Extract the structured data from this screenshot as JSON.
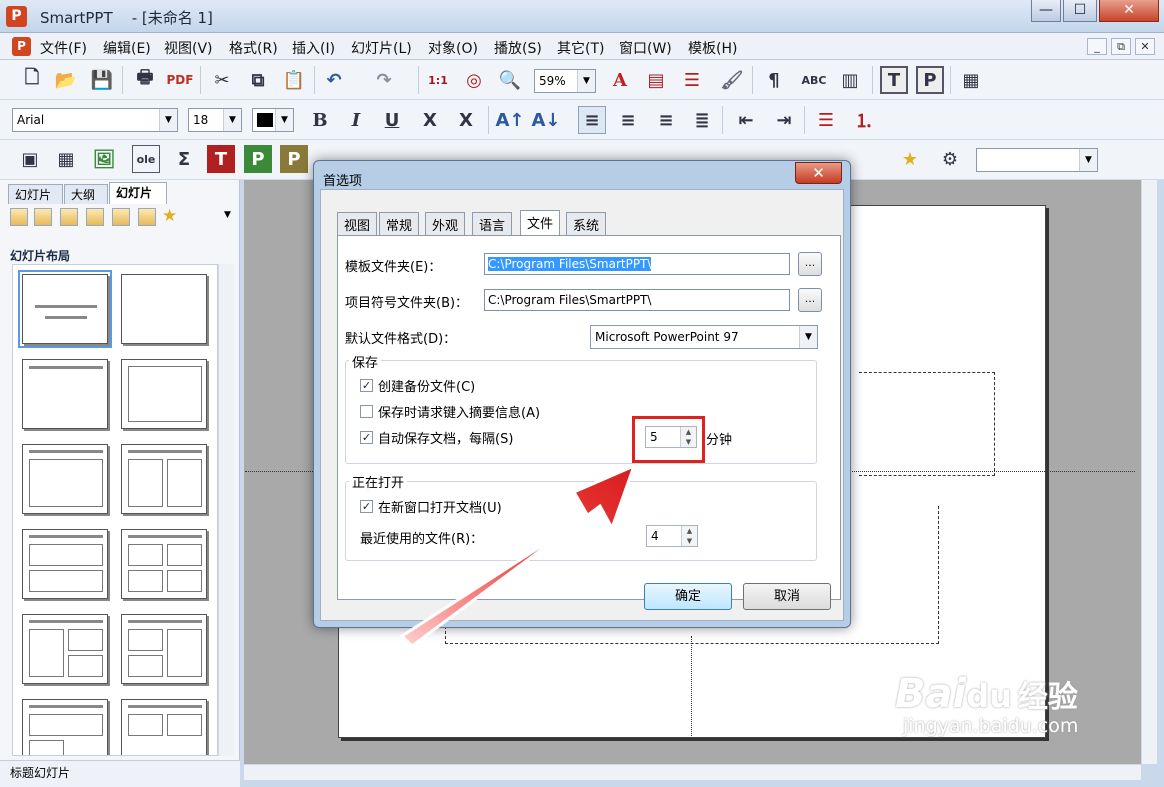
{
  "window": {
    "app_icon": "P",
    "title": "SmartPPT    - [未命名 1]",
    "controls": {
      "minimize": "—",
      "maximize": "☐",
      "close": "✕"
    }
  },
  "menu": {
    "logo": "P",
    "items": [
      "文件(F)",
      "编辑(E)",
      "视图(V)",
      "格式(R)",
      "插入(I)",
      "幻灯片(L)",
      "对象(O)",
      "播放(S)",
      "其它(T)",
      "窗口(W)",
      "模板(H)"
    ],
    "mdi_controls": [
      "_",
      "⧉",
      "✕"
    ]
  },
  "toolbar": {
    "zoom": "59%",
    "font_name": "Arial",
    "font_size": "18"
  },
  "left_panel": {
    "tabs": [
      "幻灯片",
      "大纲",
      "幻灯片"
    ],
    "layout_title": "幻灯片布局",
    "status": "标题幻灯片"
  },
  "dialog": {
    "title": "首选项",
    "close": "✕",
    "tabs": [
      "视图",
      "常规",
      "外观",
      "语言",
      "文件",
      "系统"
    ],
    "active_tab": "文件",
    "template_folder_label": "模板文件夹(E)：",
    "template_folder_value": "C:\\Program Files\\SmartPPT\\",
    "bullet_folder_label": "项目符号文件夹(B)：",
    "bullet_folder_value": "C:\\Program Files\\SmartPPT\\",
    "browse": "...",
    "default_format_label": "默认文件格式(D)：",
    "default_format_value": "Microsoft PowerPoint 97",
    "save_group": "保存",
    "backup_label": "创建备份文件(C)",
    "backup_checked": true,
    "summary_label": "保存时请求键入摘要信息(A)",
    "summary_checked": false,
    "autosave_label": "自动保存文档，每隔(S)",
    "autosave_checked": true,
    "autosave_minutes": "5",
    "minutes_unit": "分钟",
    "open_group": "正在打开",
    "new_window_label": "在新窗口打开文档(U)",
    "new_window_checked": true,
    "recent_label": "最近使用的文件(R)：",
    "recent_value": "4",
    "ok": "确定",
    "cancel": "取消"
  },
  "watermark": {
    "brand": "Bai",
    "brand2": "du",
    "suffix": "经验",
    "url": "jingyan.baidu.com"
  }
}
